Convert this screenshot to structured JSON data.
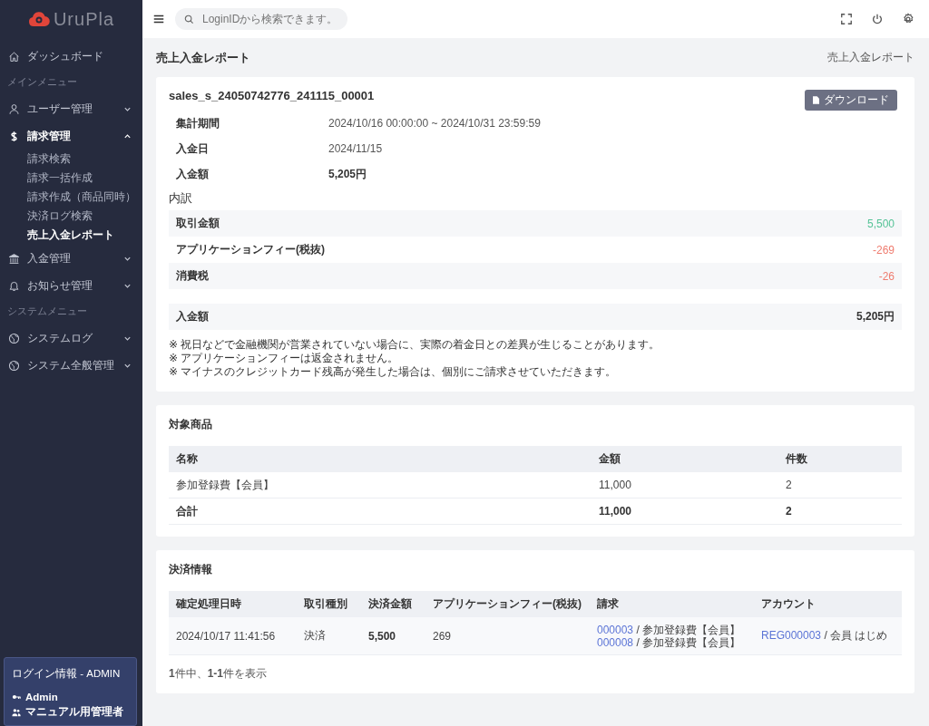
{
  "brand": "UruPla",
  "search": {
    "placeholder": "LoginIDから検索できます。"
  },
  "sidebar": {
    "items": [
      {
        "kind": "link",
        "label": "ダッシュボード",
        "selected": false
      },
      {
        "kind": "section",
        "label": "メインメニュー"
      },
      {
        "kind": "link",
        "label": "ユーザー管理",
        "selected": false,
        "expanded": false
      },
      {
        "kind": "link",
        "label": "請求管理",
        "selected": true,
        "expanded": true,
        "children": [
          {
            "label": "請求検索",
            "selected": false
          },
          {
            "label": "請求一括作成",
            "selected": false
          },
          {
            "label": "請求作成（商品同時）",
            "selected": false
          },
          {
            "label": "決済ログ検索",
            "selected": false
          },
          {
            "label": "売上入金レポート",
            "selected": true
          }
        ]
      },
      {
        "kind": "link",
        "label": "入金管理",
        "selected": false,
        "expanded": false
      },
      {
        "kind": "link",
        "label": "お知らせ管理",
        "selected": false,
        "expanded": false
      },
      {
        "kind": "section",
        "label": "システムメニュー"
      },
      {
        "kind": "link",
        "label": "システムログ",
        "selected": false,
        "expanded": false
      },
      {
        "kind": "link",
        "label": "システム全般管理",
        "selected": false,
        "expanded": false
      }
    ]
  },
  "login_info": {
    "title": "ログイン情報 - ADMIN",
    "user": "Admin",
    "role": "マニュアル用管理者"
  },
  "page": {
    "title": "売上入金レポート",
    "breadcrumb": "売上入金レポート"
  },
  "report": {
    "id": "sales_s_24050742776_241115_00001",
    "download_button": "ダウンロード",
    "fields": [
      {
        "label": "集計期間",
        "value": "2024/10/16 00:00:00 ~ 2024/10/31 23:59:59",
        "bold": false
      },
      {
        "label": "入金日",
        "value": "2024/11/15",
        "bold": false
      },
      {
        "label": "入金額",
        "value": "5,205円",
        "bold": true
      }
    ],
    "breakdown_title": "内訳",
    "breakdown": [
      {
        "label": "取引金額",
        "value": "5,500",
        "kind": "credit"
      },
      {
        "label": "アプリケーションフィー(税抜)",
        "value": "-269",
        "kind": "debit"
      },
      {
        "label": "消費税",
        "value": "-26",
        "kind": "debit"
      }
    ],
    "total": {
      "label": "入金額",
      "value": "5,205円"
    },
    "notes": [
      "※ 祝日などで金融機関が営業されていない場合に、実際の着金日との差異が生じることがあります。",
      "※ アプリケーションフィーは返金されません。",
      "※ マイナスのクレジットカード残高が発生した場合は、個別にご請求させていただきます。"
    ]
  },
  "products": {
    "title": "対象商品",
    "columns": [
      "名称",
      "金額",
      "件数"
    ],
    "rows": [
      [
        "参加登録費【会員】",
        "11,000",
        "2"
      ]
    ],
    "total_row": [
      "合計",
      "11,000",
      "2"
    ]
  },
  "payments": {
    "title": "決済情報",
    "columns": [
      "確定処理日時",
      "取引種別",
      "決済金額",
      "アプリケーションフィー(税抜)",
      "請求",
      "アカウント"
    ],
    "rows": [
      {
        "datetime": "2024/10/17 11:41:56",
        "type": "決済",
        "amount": "5,500",
        "fee": "269",
        "invoices": [
          {
            "id": "000003",
            "name": "/ 参加登録費【会員】"
          },
          {
            "id": "000008",
            "name": "/ 参加登録費【会員】"
          }
        ],
        "account": {
          "id": "REG000003",
          "name": "/ 会員 はじめ"
        }
      }
    ],
    "summary": "**1**件中、**1-1**件を表示"
  }
}
